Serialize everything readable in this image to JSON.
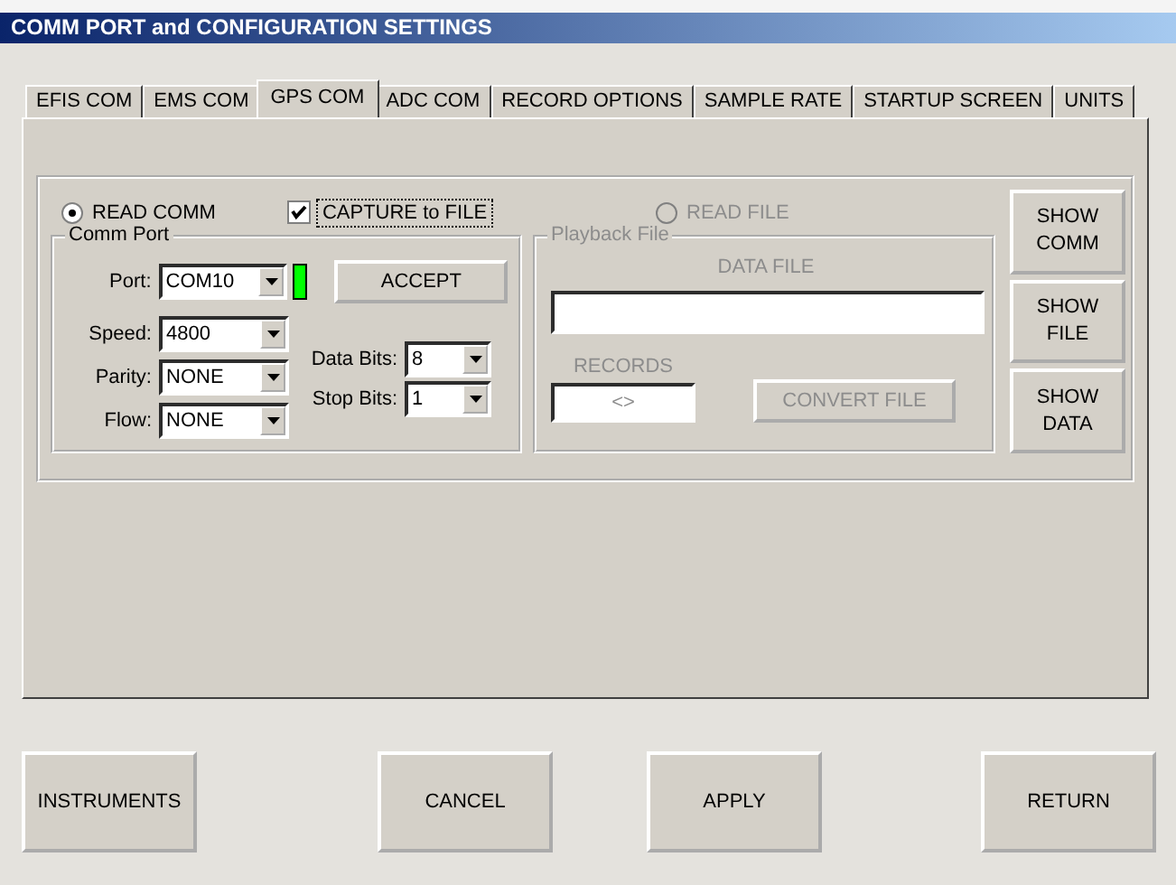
{
  "window": {
    "title": "COMM PORT and CONFIGURATION SETTINGS"
  },
  "tabs": [
    {
      "label": "EFIS COM",
      "selected": false
    },
    {
      "label": "EMS COM",
      "selected": false
    },
    {
      "label": "GPS COM",
      "selected": true
    },
    {
      "label": "ADC COM",
      "selected": false
    },
    {
      "label": "RECORD OPTIONS",
      "selected": false
    },
    {
      "label": "SAMPLE RATE",
      "selected": false
    },
    {
      "label": "STARTUP SCREEN",
      "selected": false
    },
    {
      "label": "UNITS",
      "selected": false
    }
  ],
  "read_comm": {
    "label": "READ COMM",
    "selected": true,
    "disabled": false
  },
  "capture": {
    "label": "CAPTURE to FILE",
    "checked": true
  },
  "read_file": {
    "label": "READ FILE",
    "selected": false,
    "disabled": true
  },
  "comm_port": {
    "legend": "Comm Port",
    "port": {
      "label": "Port:",
      "value": "COM10"
    },
    "port_indicator": {
      "on": true
    },
    "accept_button": "ACCEPT",
    "left_fields": [
      {
        "label": "Speed:",
        "value": "4800"
      },
      {
        "label": "Parity:",
        "value": "NONE"
      },
      {
        "label": "Flow:",
        "value": "NONE"
      }
    ],
    "right_fields": [
      {
        "label": "Data Bits:",
        "value": "8"
      },
      {
        "label": "Stop Bits:",
        "value": "1"
      }
    ]
  },
  "playback": {
    "legend": "Playback File",
    "data_file_label": "DATA FILE",
    "records_label": "RECORDS",
    "records_value": "<>",
    "convert_button": {
      "label": "CONVERT FILE",
      "disabled": true
    }
  },
  "side_buttons": [
    "SHOW COMM",
    "SHOW FILE",
    "SHOW DATA"
  ],
  "bottom_buttons": [
    "INSTRUMENTS",
    "CANCEL",
    "APPLY",
    "RETURN"
  ]
}
